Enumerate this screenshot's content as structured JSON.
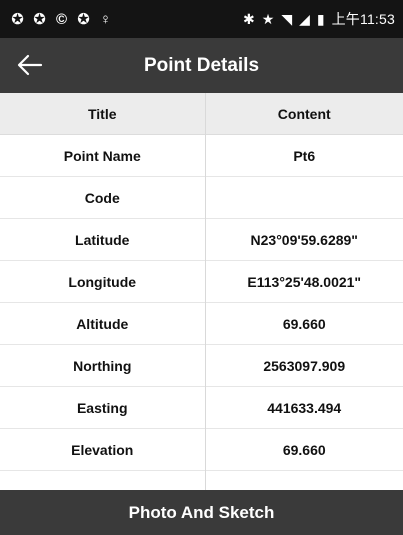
{
  "status_bar": {
    "left_icons": [
      "sync-icon",
      "sync-icon",
      "ring-icon",
      "sync-icon",
      "tack-icon"
    ],
    "left_glyphs": [
      "✪",
      "✪",
      "©",
      "✪",
      "♀"
    ],
    "bluetooth_glyph": "✱",
    "star_glyph": "★",
    "wifi_glyph": "◥",
    "signal_glyph": "◢",
    "battery_glyph": "▮",
    "time": "上午11:53"
  },
  "app_bar": {
    "back_glyph": "←",
    "title": "Point Details"
  },
  "table": {
    "headers": [
      "Title",
      "Content"
    ],
    "rows": [
      {
        "title": "Point Name",
        "content": "Pt6"
      },
      {
        "title": "Code",
        "content": ""
      },
      {
        "title": "Latitude",
        "content": "N23°09'59.6289\""
      },
      {
        "title": "Longitude",
        "content": "E113°25'48.0021\""
      },
      {
        "title": "Altitude",
        "content": "69.660"
      },
      {
        "title": "Northing",
        "content": "2563097.909"
      },
      {
        "title": "Easting",
        "content": "441633.494"
      },
      {
        "title": "Elevation",
        "content": "69.660"
      }
    ]
  },
  "footer": {
    "button_label": "Photo And Sketch"
  },
  "colors": {
    "status_bar_bg": "#141414",
    "app_bar_bg": "#3a3a3a",
    "header_row_bg": "#ececec",
    "text": "#111111"
  }
}
